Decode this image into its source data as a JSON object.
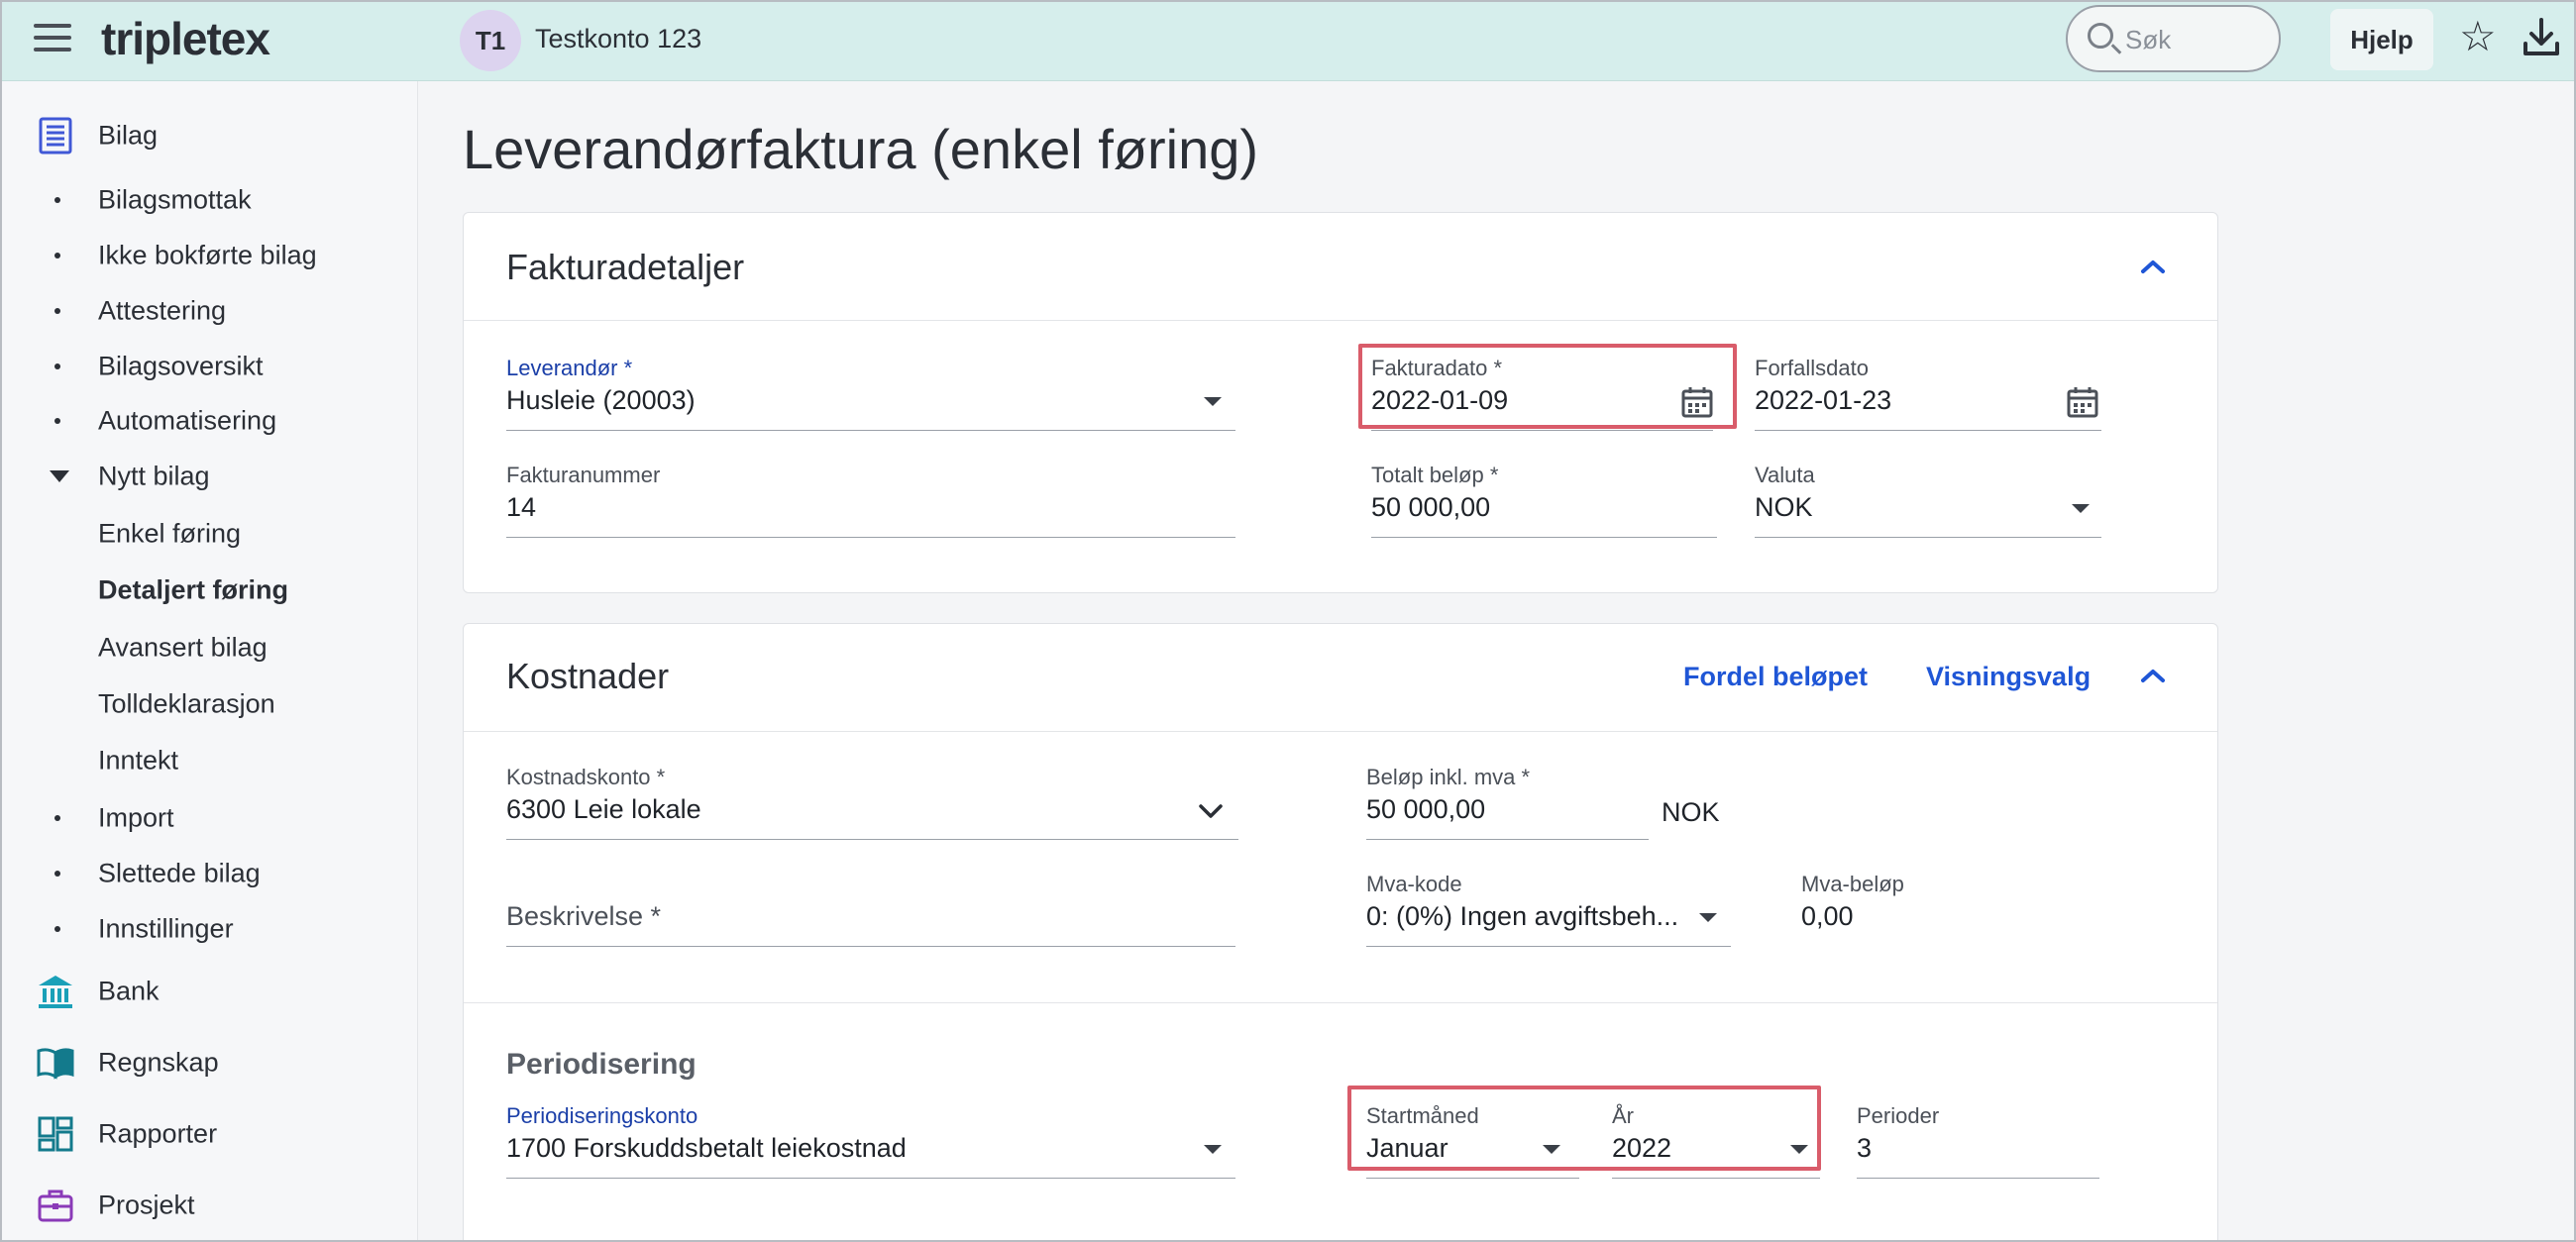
{
  "topbar": {
    "logo": "tripletex",
    "avatar_initials": "T1",
    "account_name": "Testkonto 123",
    "search_placeholder": "Søk",
    "help_label": "Hjelp",
    "icons": [
      "menu-icon",
      "search-icon",
      "star-icon",
      "download-icon"
    ]
  },
  "sidebar": {
    "bilag": "Bilag",
    "bilagsmottak": "Bilagsmottak",
    "ikke_bokforte": "Ikke bokførte bilag",
    "attestering": "Attestering",
    "bilagsoversikt": "Bilagsoversikt",
    "automatisering": "Automatisering",
    "nytt_bilag": "Nytt bilag",
    "enkel_foring": "Enkel føring",
    "detaljert_foring": "Detaljert føring",
    "avansert_bilag": "Avansert bilag",
    "tolldeklarasjon": "Tolldeklarasjon",
    "inntekt": "Inntekt",
    "import": "Import",
    "slettede_bilag": "Slettede bilag",
    "innstillinger": "Innstillinger",
    "bank": "Bank",
    "regnskap": "Regnskap",
    "rapporter": "Rapporter",
    "prosjekt": "Prosjekt"
  },
  "page": {
    "title": "Leverandørfaktura (enkel føring)"
  },
  "fakturadetaljer": {
    "title": "Fakturadetaljer",
    "leverandor_label": "Leverandør *",
    "leverandor_value": "Husleie (20003)",
    "fakturadato_label": "Fakturadato *",
    "fakturadato_value": "2022-01-09",
    "forfallsdato_label": "Forfallsdato",
    "forfallsdato_value": "2022-01-23",
    "fakturanummer_label": "Fakturanummer",
    "fakturanummer_value": "14",
    "totalt_belop_label": "Totalt beløp *",
    "totalt_belop_value": "50 000,00",
    "valuta_label": "Valuta",
    "valuta_value": "NOK"
  },
  "kostnader": {
    "title": "Kostnader",
    "fordel_link": "Fordel beløpet",
    "visningsvalg_link": "Visningsvalg",
    "kostnadskonto_label": "Kostnadskonto *",
    "kostnadskonto_value": "6300 Leie lokale",
    "belop_label": "Beløp inkl. mva *",
    "belop_value": "50 000,00",
    "belop_currency": "NOK",
    "beskrivelse_label": "Beskrivelse *",
    "mva_kode_label": "Mva-kode",
    "mva_kode_value": "0: (0%) Ingen avgiftsbeh...",
    "mva_belop_label": "Mva-beløp",
    "mva_belop_value": "0,00",
    "periodisering_title": "Periodisering",
    "periodiseringskonto_label": "Periodiseringskonto",
    "periodiseringskonto_value": "1700 Forskuddsbetalt leiekostnad",
    "startmaned_label": "Startmåned",
    "startmaned_value": "Januar",
    "ar_label": "År",
    "ar_value": "2022",
    "perioder_label": "Perioder",
    "perioder_value": "3"
  },
  "colors": {
    "topbar_bg": "#d6eeec",
    "link_blue": "#1f56d6",
    "highlight_red": "#d95c6a"
  }
}
